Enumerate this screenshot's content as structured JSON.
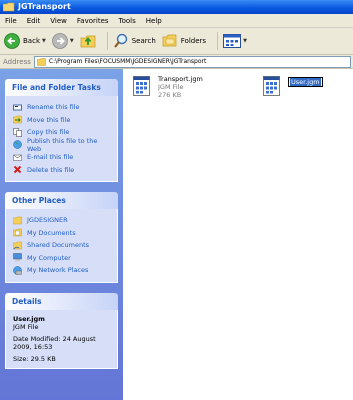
{
  "window": {
    "title": "JGTransport"
  },
  "menu": [
    "File",
    "Edit",
    "View",
    "Favorites",
    "Tools",
    "Help"
  ],
  "toolbar": {
    "back_label": "Back",
    "search_label": "Search",
    "folders_label": "Folders"
  },
  "address": {
    "label": "Address",
    "path": "C:\\Program Files\\FOCUSMM\\JGDESIGNER\\JGTransport"
  },
  "file_tasks": {
    "title": "File and Folder Tasks",
    "items": [
      "Rename this file",
      "Move this file",
      "Copy this file",
      "Publish this file to the Web",
      "E-mail this file",
      "Delete this file"
    ]
  },
  "other_places": {
    "title": "Other Places",
    "items": [
      "JGDESIGNER",
      "My Documents",
      "Shared Documents",
      "My Computer",
      "My Network Places"
    ]
  },
  "details": {
    "title": "Details",
    "name": "User.jgm",
    "type": "JGM File",
    "modified": "Date Modified: 24 August 2009, 16:53",
    "size": "Size: 29.5 KB"
  },
  "files": [
    {
      "name": "Transport.jgm",
      "type": "JGM File",
      "size": "276 KB"
    },
    {
      "name": "User.jgm",
      "type": "JGM File",
      "size": "29.5 KB",
      "renaming": true
    }
  ],
  "colors": {
    "title_bar": "#0a5ae0",
    "sidebar": "#7ba2e7",
    "link": "#215dc6",
    "selection": "#316ac5"
  }
}
